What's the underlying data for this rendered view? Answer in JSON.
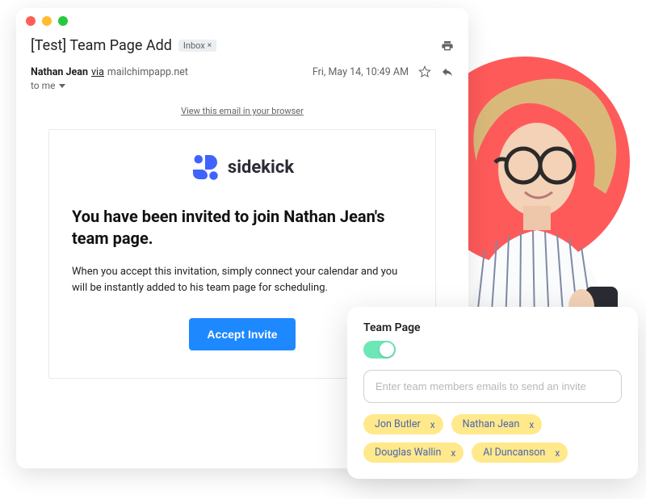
{
  "email": {
    "subject": "[Test] Team Page Add",
    "inbox_badge": "Inbox",
    "from_name": "Nathan Jean",
    "via_word": "via",
    "from_domain": "mailchimpapp.net",
    "timestamp": "Fri, May 14, 10:49 AM",
    "to_line": "to me",
    "view_in_browser": "View this email in your browser",
    "brand_name": "sidekick",
    "invite_heading": "You have been invited to join Nathan Jean's team page.",
    "invite_desc": "When you accept this invitation, simply connect your calendar and you will be instantly added to his team page for scheduling.",
    "accept_label": "Accept Invite"
  },
  "team_card": {
    "title": "Team Page",
    "placeholder": "Enter team members emails to send an invite",
    "chips": [
      "Jon Butler",
      "Nathan Jean",
      "Douglas Wallin",
      "Al Duncanson"
    ]
  }
}
